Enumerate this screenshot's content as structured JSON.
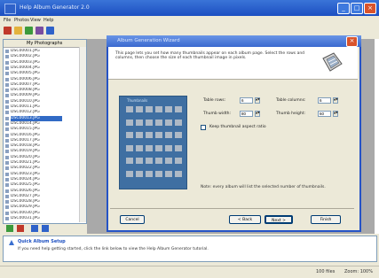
{
  "window": {
    "title": "Help Album Generator 2.0",
    "controls": {
      "minimize": "_",
      "maximize": "□",
      "close": "×"
    }
  },
  "menu": [
    "File",
    "Photos",
    "View",
    "Help"
  ],
  "toolbar": {
    "icons": [
      "new-album-icon",
      "open-icon",
      "add-photos-icon",
      "save-icon",
      "export-icon"
    ],
    "colors": {
      "red": "#c0392b",
      "yellow": "#e3b23c",
      "green": "#3c9a3c",
      "purple": "#7a4da0",
      "blue": "#2f62c9"
    }
  },
  "left_panel": {
    "header": "My Photographs",
    "files": [
      "DSC00001.JPG",
      "DSC00002.JPG",
      "DSC00003.JPG",
      "DSC00004.JPG",
      "DSC00005.JPG",
      "DSC00006.JPG",
      "DSC00007.JPG",
      "DSC00008.JPG",
      "DSC00009.JPG",
      "DSC00010.JPG",
      "DSC00011.JPG",
      "DSC00012.JPG",
      "DSC00013.JPG",
      "DSC00014.JPG",
      "DSC00015.JPG",
      "DSC00016.JPG",
      "DSC00017.JPG",
      "DSC00018.JPG",
      "DSC00019.JPG",
      "DSC00020.JPG",
      "DSC00021.JPG",
      "DSC00022.JPG",
      "DSC00023.JPG",
      "DSC00024.JPG",
      "DSC00025.JPG",
      "DSC00026.JPG",
      "DSC00027.JPG",
      "DSC00028.JPG",
      "DSC00029.JPG",
      "DSC00030.JPG",
      "DSC00031.JPG"
    ],
    "selected_index": 12
  },
  "info": {
    "title": "Quick Album Setup",
    "text": "If you need help getting started, click the link below to view the Help Album Generator tutorial."
  },
  "status": {
    "left": "",
    "right1": "100 files",
    "right2": "Zoom: 100%"
  },
  "dialog": {
    "title": "Album Generation Wizard",
    "intro": "This page lets you set how many thumbnails appear on each album page. Select the rows and columns, then choose the size of each thumbnail image in pixels.",
    "grid_label": "Thumbnails",
    "rows": 6,
    "cols": 6,
    "fields": {
      "rows_label": "Table rows:",
      "rows_value": "6",
      "cols_label": "Table columns:",
      "cols_value": "6",
      "width_label": "Thumb width:",
      "width_value": "80",
      "height_label": "Thumb height:",
      "height_value": "60"
    },
    "checkbox_label": "Keep thumbnail aspect ratio",
    "note": "Note: every album will list the selected number of thumbnails.",
    "buttons": {
      "cancel": "Cancel",
      "back": "< Back",
      "next": "Next >",
      "finish": "Finish"
    }
  }
}
